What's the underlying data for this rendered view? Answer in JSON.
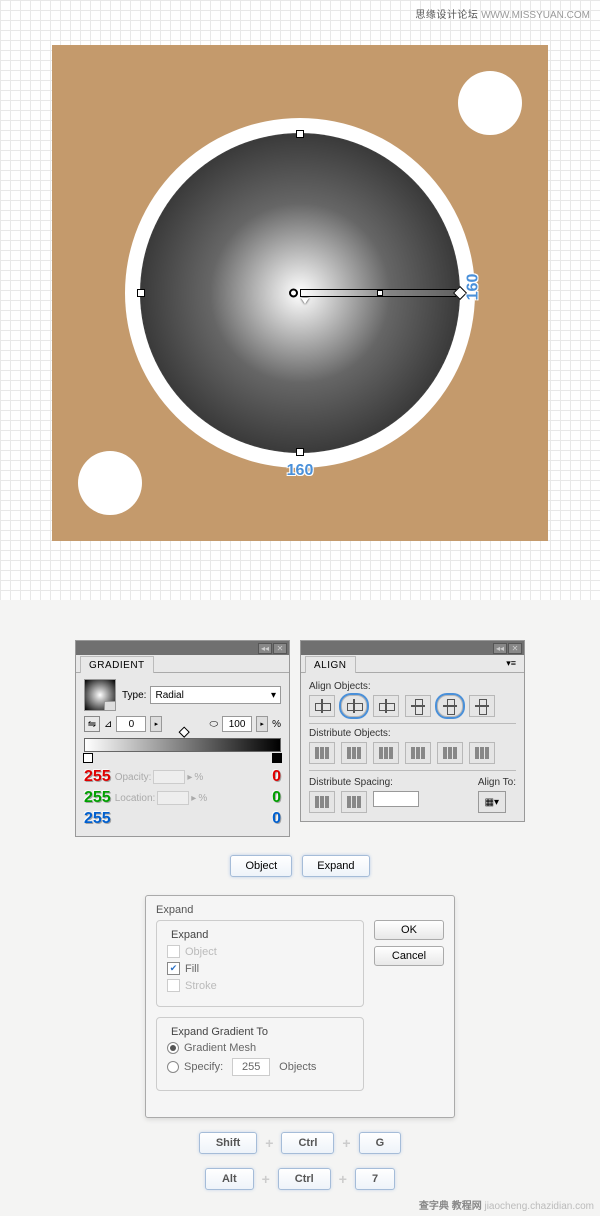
{
  "watermarks": {
    "top_cn": "思缘设计论坛",
    "top_url": "WWW.MISSYUAN.COM",
    "bot_cn": "查字典 教程网",
    "bot_url": "jiaocheng.chazidian.com"
  },
  "canvas": {
    "dim_w": "160",
    "dim_h": "160"
  },
  "gradient_panel": {
    "title": "GRADIENT",
    "type_label": "Type:",
    "type_value": "Radial",
    "angle": "0",
    "aspect": "100",
    "pct": "%",
    "rgb_left": {
      "r": "255",
      "g": "255",
      "b": "255"
    },
    "rgb_right": {
      "r": "0",
      "g": "0",
      "b": "0"
    },
    "opacity_label": "Opacity:",
    "location_label": "Location:"
  },
  "align_panel": {
    "title": "ALIGN",
    "align_label": "Align Objects:",
    "distribute_label": "Distribute Objects:",
    "spacing_label": "Distribute Spacing:",
    "alignto_label": "Align To:"
  },
  "actions": {
    "object": "Object",
    "expand": "Expand"
  },
  "dialog": {
    "title": "Expand",
    "group1": "Expand",
    "object": "Object",
    "fill": "Fill",
    "stroke": "Stroke",
    "group2": "Expand Gradient To",
    "gradient_mesh": "Gradient Mesh",
    "specify": "Specify:",
    "specify_value": "255",
    "specify_suffix": "Objects",
    "ok": "OK",
    "cancel": "Cancel"
  },
  "shortcuts": {
    "shift": "Shift",
    "ctrl": "Ctrl",
    "alt": "Alt",
    "g": "G",
    "seven": "7",
    "plus": "+"
  }
}
